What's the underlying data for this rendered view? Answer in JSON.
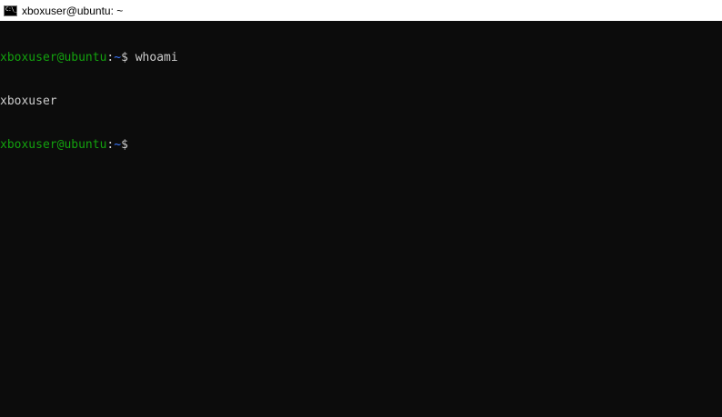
{
  "window": {
    "title": "xboxuser@ubuntu: ~"
  },
  "icons": {
    "app": "console-icon"
  },
  "colors": {
    "background": "#0c0c0c",
    "prompt_user": "#13a10e",
    "prompt_path": "#3b78ff",
    "text": "#cccccc"
  },
  "terminal": {
    "lines": [
      {
        "user": "xboxuser@ubuntu",
        "sep": ":",
        "path": "~",
        "dollar": "$",
        "command": " whoami"
      },
      {
        "output": "xboxuser"
      },
      {
        "user": "xboxuser@ubuntu",
        "sep": ":",
        "path": "~",
        "dollar": "$",
        "command": ""
      }
    ]
  }
}
